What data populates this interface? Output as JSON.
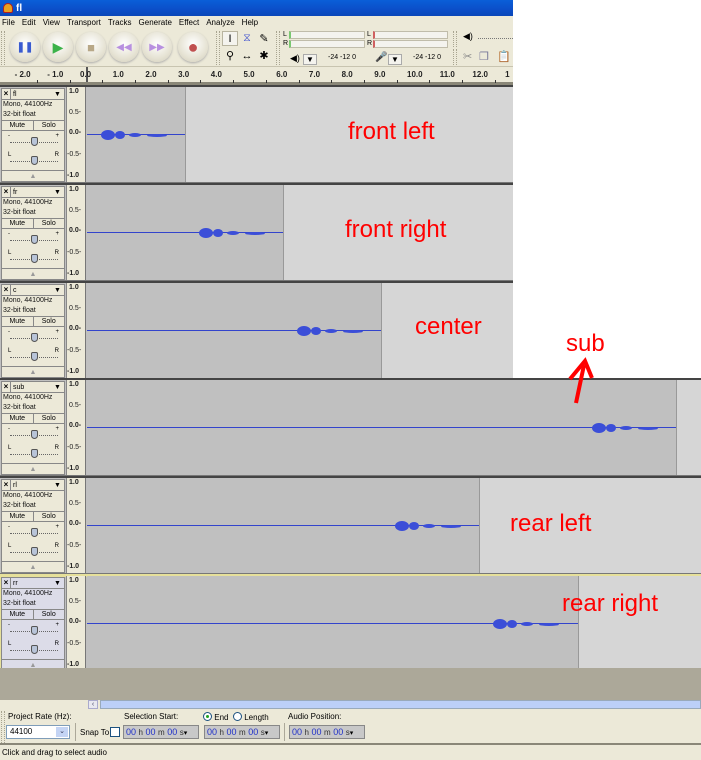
{
  "window": {
    "title": "fl"
  },
  "menu": [
    "File",
    "Edit",
    "View",
    "Transport",
    "Tracks",
    "Generate",
    "Effect",
    "Analyze",
    "Help"
  ],
  "transport_buttons": [
    {
      "name": "pause",
      "glyph": "❚❚",
      "color": "#3a5bd0"
    },
    {
      "name": "play",
      "glyph": "▶",
      "color": "#3cb34a"
    },
    {
      "name": "stop",
      "glyph": "■",
      "color": "#b8a888"
    },
    {
      "name": "skip-start",
      "glyph": "⏮",
      "color": "#b890e0"
    },
    {
      "name": "skip-end",
      "glyph": "⏭",
      "color": "#b890e0"
    },
    {
      "name": "record",
      "glyph": "●",
      "color": "#c05050"
    }
  ],
  "tools": [
    {
      "name": "selection-tool",
      "glyph": "I",
      "selected": true
    },
    {
      "name": "envelope-tool",
      "glyph": "⧖",
      "selected": false
    },
    {
      "name": "draw-tool",
      "glyph": "✎",
      "selected": false
    },
    {
      "name": "zoom-tool",
      "glyph": "⚲",
      "selected": false
    },
    {
      "name": "timeshift-tool",
      "glyph": "↔",
      "selected": false
    },
    {
      "name": "multi-tool",
      "glyph": "✱",
      "selected": false
    }
  ],
  "meters": {
    "play": {
      "l": "L",
      "r": "R",
      "scale": "-24  -12  0"
    },
    "record": {
      "l": "L",
      "r": "R",
      "scale": "-24  -12  0"
    }
  },
  "ruler": {
    "labels": [
      "- 2.0",
      "- 1.0",
      "0.0",
      "1.0",
      "2.0",
      "3.0",
      "4.0",
      "5.0",
      "6.0",
      "7.0",
      "8.0",
      "9.0",
      "10.0",
      "11.0",
      "12.0",
      "1"
    ]
  },
  "track_common": {
    "info1": "Mono, 44100Hz",
    "info2": "32-bit float",
    "mute": "Mute",
    "solo": "Solo",
    "gain_minus": "-",
    "gain_plus": "+",
    "pan_left": "L",
    "pan_right": "R",
    "scale": [
      "1.0",
      "0.5-",
      "0.0-",
      "-0.5-",
      "-1.0"
    ]
  },
  "tracks": [
    {
      "name": "fl",
      "label": "front left",
      "clip_end_sec": 3.0,
      "burst_start_sec": 0.0,
      "selected": false
    },
    {
      "name": "fr",
      "label": "front right",
      "clip_end_sec": 6.0,
      "burst_start_sec": 3.0,
      "selected": false
    },
    {
      "name": "c",
      "label": "center",
      "clip_end_sec": 9.0,
      "burst_start_sec": 6.0,
      "selected": false
    },
    {
      "name": "sub",
      "label": "sub",
      "clip_end_sec": 18.0,
      "burst_start_sec": 15.0,
      "selected": false
    },
    {
      "name": "rl",
      "label": "rear left",
      "clip_end_sec": 12.0,
      "burst_start_sec": 9.0,
      "selected": false
    },
    {
      "name": "rr",
      "label": "rear right",
      "clip_end_sec": 15.0,
      "burst_start_sec": 12.0,
      "selected": true
    }
  ],
  "annotation_arrow_color": "#ff0000",
  "selection_bar": {
    "project_rate_label": "Project Rate (Hz):",
    "project_rate_value": "44100",
    "snap_to_label": "Snap To",
    "selection_start_label": "Selection Start:",
    "end_label": "End",
    "length_label": "Length",
    "end_selected": true,
    "audio_position_label": "Audio Position:",
    "time_hours": "00",
    "time_minutes": "00",
    "time_seconds": "00",
    "unit_h": "h",
    "unit_m": "m",
    "unit_s": "s"
  },
  "status": "Click and drag to select audio"
}
